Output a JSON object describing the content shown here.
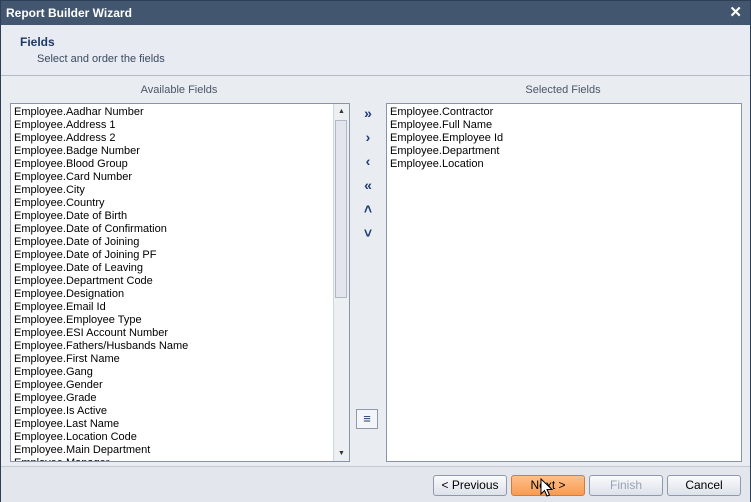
{
  "window": {
    "title": "Report Builder Wizard",
    "close_glyph": "✕"
  },
  "header": {
    "title": "Fields",
    "subtitle": "Select and order the fields"
  },
  "available": {
    "label": "Available Fields",
    "items": [
      "Employee.Aadhar Number",
      "Employee.Address 1",
      "Employee.Address 2",
      "Employee.Badge Number",
      "Employee.Blood Group",
      "Employee.Card Number",
      "Employee.City",
      "Employee.Country",
      "Employee.Date of Birth",
      "Employee.Date of Confirmation",
      "Employee.Date of Joining",
      "Employee.Date of Joining PF",
      "Employee.Date of Leaving",
      "Employee.Department Code",
      "Employee.Designation",
      "Employee.Email Id",
      "Employee.Employee Type",
      "Employee.ESI Account Number",
      "Employee.Fathers/Husbands Name",
      "Employee.First Name",
      "Employee.Gang",
      "Employee.Gender",
      "Employee.Grade",
      "Employee.Is Active",
      "Employee.Last Name",
      "Employee.Location Code",
      "Employee.Main Department",
      "Employee.Manager"
    ]
  },
  "selected": {
    "label": "Selected Fields",
    "items": [
      "Employee.Contractor",
      "Employee.Full Name",
      "Employee.Employee Id",
      "Employee.Department",
      "Employee.Location"
    ]
  },
  "tools": {
    "add_all": "»",
    "add": "›",
    "remove": "‹",
    "remove_all": "«",
    "move_up": "˄",
    "move_down": "˅",
    "sort": "≡"
  },
  "scroll": {
    "up": "▲",
    "down": "▼"
  },
  "footer": {
    "previous": "< Previous",
    "next": "Next >",
    "finish": "Finish",
    "cancel": "Cancel"
  }
}
